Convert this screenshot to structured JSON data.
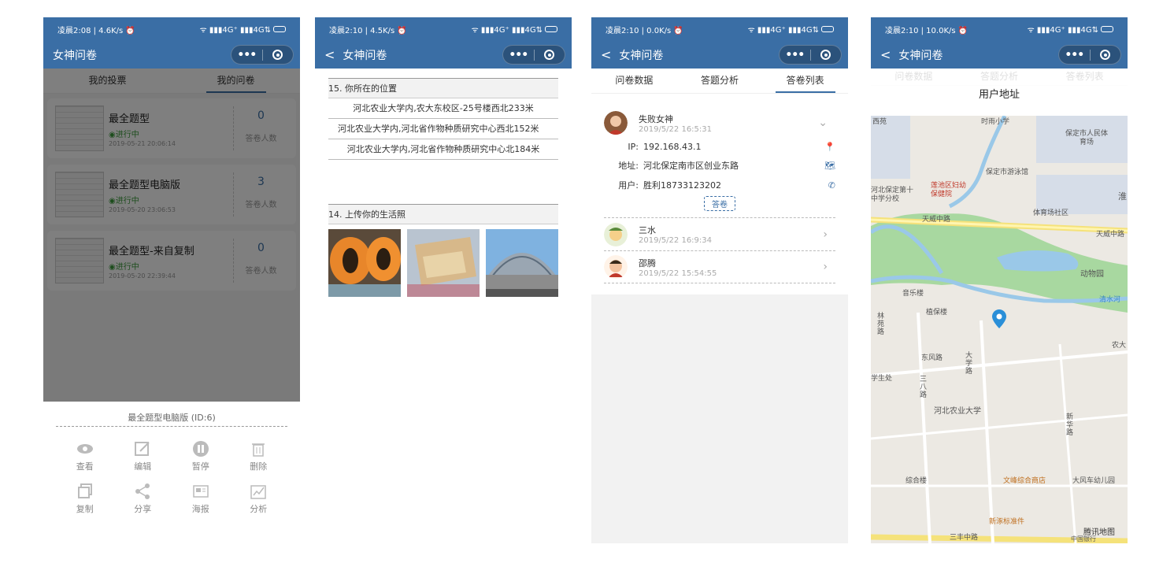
{
  "status_bars": [
    {
      "time": "凌晨2:08 | 4.6K/s ⏰",
      "signal": "ᯤ ▮▮▮4G⁺ ▮▮▮4G⇅"
    },
    {
      "time": "凌晨2:10 | 4.5K/s ⏰",
      "signal": "ᯤ ▮▮▮4G⁺ ▮▮▮4G⇅"
    },
    {
      "time": "凌晨2:10 | 0.0K/s ⏰",
      "signal": "ᯤ ▮▮▮4G⁺ ▮▮▮4G⇅"
    },
    {
      "time": "凌晨2:10 | 10.0K/s ⏰",
      "signal": "ᯤ ▮▮▮4G⁺ ▮▮▮4G⇅"
    }
  ],
  "app_title": "女神问卷",
  "screen1": {
    "tabs": [
      "我的投票",
      "我的问卷"
    ],
    "active_tab": 1,
    "surveys": [
      {
        "title": "最全题型",
        "status": "◉进行中",
        "date": "2019-05-21 20:06:14",
        "count": "0",
        "count_label": "答卷人数"
      },
      {
        "title": "最全题型电脑版",
        "status": "◉进行中",
        "date": "2019-05-20 23:06:53",
        "count": "3",
        "count_label": "答卷人数"
      },
      {
        "title": "最全题型-来自复制",
        "status": "◉进行中",
        "date": "2019-05-20 22:39:44",
        "count": "0",
        "count_label": "答卷人数"
      }
    ],
    "sheet_title": "最全题型电脑版  (ID:6)",
    "actions": [
      {
        "label": "查看",
        "icon": "eye-icon"
      },
      {
        "label": "编辑",
        "icon": "edit-icon"
      },
      {
        "label": "暂停",
        "icon": "pause-icon"
      },
      {
        "label": "删除",
        "icon": "trash-icon"
      },
      {
        "label": "复制",
        "icon": "copy-icon"
      },
      {
        "label": "分享",
        "icon": "share-icon"
      },
      {
        "label": "海报",
        "icon": "poster-icon"
      },
      {
        "label": "分析",
        "icon": "chart-icon"
      }
    ]
  },
  "screen2": {
    "q15_title": "15.  你所在的位置",
    "locations": [
      "河北农业大学内,农大东校区-25号楼西北233米",
      "河北农业大学内,河北省作物种质研究中心西北152米",
      "河北农业大学内,河北省作物种质研究中心北184米"
    ],
    "q14_title": "14.  上传你的生活照"
  },
  "screen3": {
    "tabs": [
      "问卷数据",
      "答题分析",
      "答卷列表"
    ],
    "active_tab": 2,
    "expanded": {
      "name": "失败女神",
      "time": "2019/5/22 16:5:31",
      "ip_label": "IP:",
      "ip": "192.168.43.1",
      "addr_label": "地址:",
      "addr": "河北保定南市区创业东路",
      "user_label": "用户:",
      "user": "胜利18733123202",
      "answer_btn": "答卷"
    },
    "others": [
      {
        "name": "三水",
        "time": "2019/5/22 16:9:34"
      },
      {
        "name": "邵腾",
        "time": "2019/5/22 15:54:55"
      }
    ]
  },
  "screen4": {
    "faded_tabs": [
      "问卷数据",
      "答题分析",
      "答卷列表"
    ],
    "dialog_title": "用户地址",
    "map_labels": [
      "时雨小学",
      "保定市人民体育场",
      "保定市游泳馆",
      "河北保定第十中学分校",
      "莲池区妇幼保健院",
      "天威中路",
      "体育场社区",
      "淮",
      "天威中路",
      "动物园",
      "清水河",
      "音乐楼",
      "植保楼",
      "林苑路",
      "农大",
      "学生处",
      "东风路",
      "大学路",
      "三八路",
      "河北农业大学",
      "新华路",
      "综合楼",
      "文峰综合商店",
      "大风车幼儿园",
      "新涿标准件",
      "三丰中路",
      "中国银行",
      "腾讯地图",
      "西苑"
    ]
  }
}
